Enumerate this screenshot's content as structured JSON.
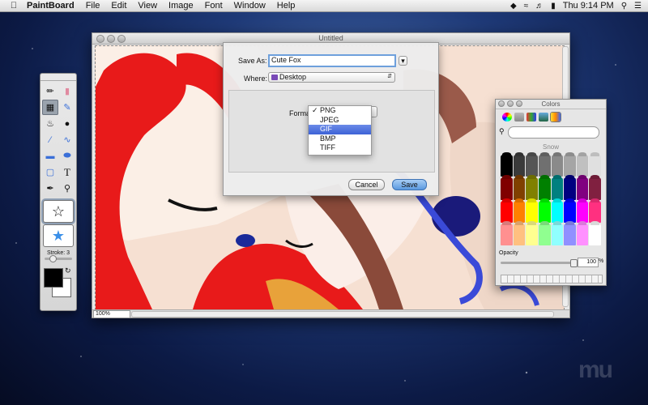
{
  "menubar": {
    "app_name": "PaintBoard",
    "items": [
      "File",
      "Edit",
      "View",
      "Image",
      "Font",
      "Window",
      "Help"
    ],
    "clock": "Thu 9:14 PM"
  },
  "window": {
    "title": "Untitled",
    "zoom": "100%"
  },
  "tools": {
    "stroke_label": "Stroke: 3",
    "fg_color": "#000000",
    "bg_color": "#ffffff"
  },
  "save_sheet": {
    "save_as_label": "Save As:",
    "filename": "Cute Fox",
    "where_label": "Where:",
    "where_value": "Desktop",
    "format_label": "Format",
    "format_options": [
      {
        "label": "PNG",
        "checked": true
      },
      {
        "label": "JPEG",
        "checked": false
      },
      {
        "label": "GIF",
        "checked": false,
        "highlighted": true
      },
      {
        "label": "BMP",
        "checked": false
      },
      {
        "label": "TIFF",
        "checked": false
      }
    ],
    "cancel_label": "Cancel",
    "save_label": "Save",
    "accent_color": "#5b9ae0"
  },
  "colors_panel": {
    "title": "Colors",
    "selected_name": "Snow",
    "opacity_label": "Opacity",
    "opacity_value": "100",
    "opacity_unit": "%",
    "crayon_colors": [
      "#000000",
      "#3a3a3a",
      "#555555",
      "#707070",
      "#8a8a8a",
      "#a5a5a5",
      "#c0c0c0",
      "#e0e0e0",
      "#800000",
      "#804000",
      "#808000",
      "#008000",
      "#008080",
      "#000080",
      "#800080",
      "#802040",
      "#ff0000",
      "#ff8000",
      "#ffff00",
      "#00ff00",
      "#00ffff",
      "#0000ff",
      "#ff00ff",
      "#ff3080",
      "#ff9090",
      "#ffc080",
      "#ffff90",
      "#90ff90",
      "#90ffff",
      "#9090ff",
      "#ff90ff",
      "#ffffff"
    ]
  },
  "watermark": "mu"
}
